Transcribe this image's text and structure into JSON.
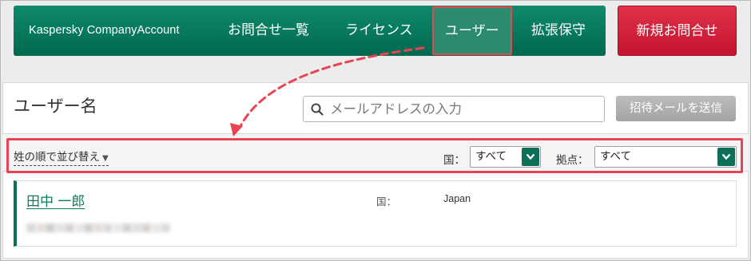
{
  "nav": {
    "brand": "Kaspersky CompanyAccount",
    "items": [
      {
        "label": "お問合せ一覧"
      },
      {
        "label": "ライセンス"
      },
      {
        "label": "ユーザー"
      },
      {
        "label": "拡張保守"
      }
    ],
    "new_inquiry": "新規お問合せ"
  },
  "main": {
    "title": "ユーザー名",
    "search_placeholder": "メールアドレスの入力",
    "invite_button": "招待メールを送信"
  },
  "filters": {
    "sort_label": "姓の順で並び替え",
    "sort_arrow": "▼",
    "country_label": "国：",
    "country_value": "すべて",
    "location_label": "拠点：",
    "location_value": "すべて"
  },
  "users": [
    {
      "name": "田中 一郎",
      "country_label": "国：",
      "country": "Japan"
    }
  ],
  "colors": {
    "brand_green": "#00684f",
    "accent_red": "#e84454",
    "cta_red": "#c4142f"
  }
}
